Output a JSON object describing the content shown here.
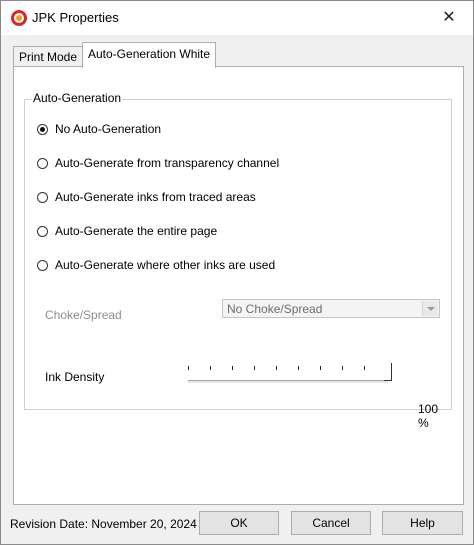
{
  "window": {
    "title": "JPK Properties",
    "close_symbol": "✕",
    "app_icon": "jpk-logo-icon"
  },
  "tabs": [
    {
      "label": "Print Mode",
      "active": false
    },
    {
      "label": "Auto-Generation White",
      "active": true
    }
  ],
  "auto_generation": {
    "group_label": "Auto-Generation",
    "options": [
      {
        "label": "No Auto-Generation",
        "checked": true
      },
      {
        "label": "Auto-Generate from transparency channel",
        "checked": false
      },
      {
        "label": "Auto-Generate inks from traced areas",
        "checked": false
      },
      {
        "label": "Auto-Generate the entire page",
        "checked": false
      },
      {
        "label": "Auto-Generate where other inks are used",
        "checked": false
      }
    ],
    "choke_spread": {
      "label": "Choke/Spread",
      "value": "No Choke/Spread",
      "enabled": false
    },
    "ink_density": {
      "label": "Ink Density",
      "value_text": "100 %",
      "level": 1.0
    }
  },
  "footer": {
    "revision_text": "Revision Date: November 20, 2024",
    "ok_label": "OK",
    "cancel_label": "Cancel",
    "help_label": "Help"
  },
  "colors": {
    "window_bg": "#f0f0f0",
    "panel_bg": "#ffffff",
    "disabled_text": "#8d8d8d"
  }
}
